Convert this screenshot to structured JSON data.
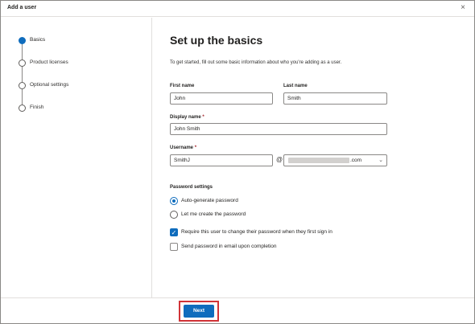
{
  "dialog": {
    "title": "Add a user",
    "close_icon": "×"
  },
  "stepper": {
    "steps": [
      {
        "label": "Basics",
        "active": true
      },
      {
        "label": "Product licenses",
        "active": false
      },
      {
        "label": "Optional settings",
        "active": false
      },
      {
        "label": "Finish",
        "active": false
      }
    ]
  },
  "form": {
    "heading": "Set up the basics",
    "intro": "To get started, fill out some basic information about who you're adding as a user.",
    "first_name": {
      "label": "First name",
      "value": "John"
    },
    "last_name": {
      "label": "Last name",
      "value": "Smith"
    },
    "display_name": {
      "label": "Display name",
      "required_mark": "*",
      "value": "John Smith"
    },
    "username": {
      "label": "Username",
      "required_mark": "*",
      "value": "SmithJ",
      "at": "@",
      "domain_suffix": ".com",
      "domain_chevron_icon": "chevron-down-icon"
    },
    "password_settings": {
      "label": "Password settings",
      "auto_generate": {
        "label": "Auto-generate password",
        "selected": true
      },
      "let_me_create": {
        "label": "Let me create the password",
        "selected": false
      },
      "require_change": {
        "label": "Require this user to change their password when they first sign in",
        "checked": true
      },
      "send_email": {
        "label": "Send password in email upon completion",
        "checked": false
      }
    }
  },
  "footer": {
    "next_label": "Next"
  },
  "colors": {
    "accent": "#0f6cbd",
    "highlight": "#d13438"
  }
}
